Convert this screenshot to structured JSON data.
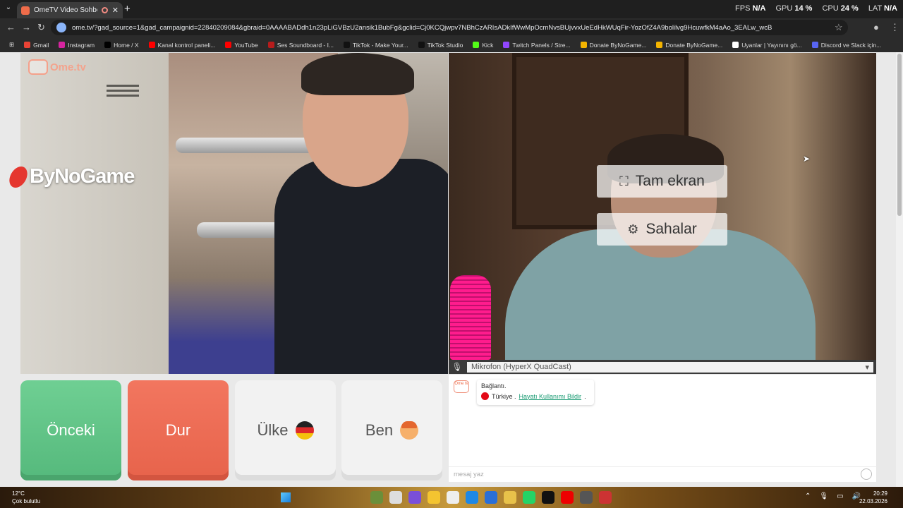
{
  "browser": {
    "tab_title": "OmeTV Video Sohbeti — O",
    "new_tab": "+",
    "close_tab": "✕",
    "url": "ome.tv/?gad_source=1&gad_campaignid=22840209084&gbraid=0AAAABADdh1n23pLiGVBzU2ansik1BubFg&gclid=Cj0KCQjwpv7NBhCzARIsADkIfWwMpOcmNvsBUjvvxUeEdHkWUqFir-YozOfZ4A9bolilvg9HcuwfkM4aAo_3EALw_wcB",
    "bookmarks": [
      {
        "label": "Gmail",
        "color": "#ea4335"
      },
      {
        "label": "Instagram",
        "color": "#d6249f"
      },
      {
        "label": "Home / X",
        "color": "#000000"
      },
      {
        "label": "Kanal kontrol paneli...",
        "color": "#ff0000"
      },
      {
        "label": "YouTube",
        "color": "#ff0000"
      },
      {
        "label": "Ses Soundboard - I...",
        "color": "#b71c1c"
      },
      {
        "label": "TikTok - Make Your...",
        "color": "#111111"
      },
      {
        "label": "TikTok Studio",
        "color": "#111111"
      },
      {
        "label": "Kick",
        "color": "#53fc18"
      },
      {
        "label": "Twitch Panels / Stre...",
        "color": "#9146ff"
      },
      {
        "label": "Donate ByNoGame...",
        "color": "#f4b400"
      },
      {
        "label": "Donate ByNoGame...",
        "color": "#f4b400"
      },
      {
        "label": "Uyanlar | Yayınını gö...",
        "color": "#ffffff"
      },
      {
        "label": "Discord ve Slack için...",
        "color": "#5865f2"
      }
    ]
  },
  "perf_overlay": {
    "fps_label": "FPS",
    "fps_value": "N/A",
    "gpu_label": "GPU",
    "gpu_value": "14 %",
    "cpu_label": "CPU",
    "cpu_value": "24 %",
    "lat_label": "LAT",
    "lat_value": "N/A"
  },
  "site": {
    "logo_text": "Ome.tv",
    "stream_watermark": "ByNoGame",
    "overlay_buttons": {
      "fullscreen": "Tam ekran",
      "settings": "Sahalar"
    },
    "microphone_select": "Mikrofon (HyperX QuadCast)",
    "buttons": {
      "previous": "Önceki",
      "stop": "Dur",
      "country": "Ülke",
      "me": "Ben"
    },
    "chat": {
      "badge": "Ome tv",
      "connected": "Bağlantı.",
      "country": "Türkiye .",
      "report_link": "Hayatı Kullanımı Bildir",
      "report_suffix": ".",
      "input_placeholder": "mesaj yaz"
    }
  },
  "taskbar": {
    "temperature": "12°C",
    "weather": "Çok bulutlu",
    "time": "20:29",
    "date": "22.03.2026"
  },
  "colors": {
    "prev_green": "#5fc487",
    "stop_red": "#ec6a52",
    "link_green": "#1a9b73"
  }
}
